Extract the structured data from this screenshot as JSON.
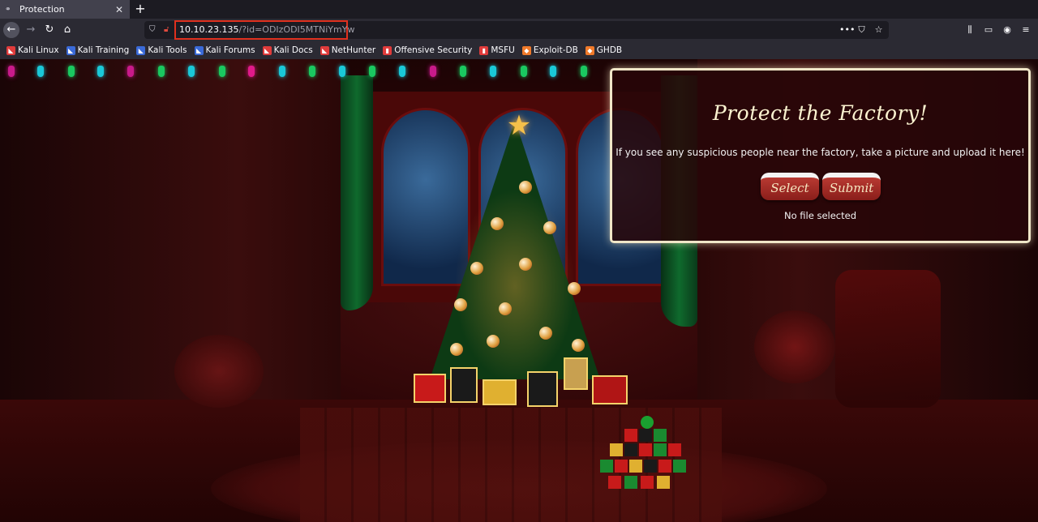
{
  "browser": {
    "tab": {
      "title": "Protection"
    },
    "url": {
      "host": "10.10.23.135",
      "path": "/?id=ODIzODI5MTNiYmYw"
    },
    "bookmarks": [
      {
        "label": "Kali Linux",
        "icon": "kali-icon",
        "color": "#e03b3b"
      },
      {
        "label": "Kali Training",
        "icon": "kali-training-icon",
        "color": "#3a6ad8"
      },
      {
        "label": "Kali Tools",
        "icon": "kali-tools-icon",
        "color": "#3a6ad8"
      },
      {
        "label": "Kali Forums",
        "icon": "kali-forums-icon",
        "color": "#3a6ad8"
      },
      {
        "label": "Kali Docs",
        "icon": "kali-docs-icon",
        "color": "#e03b3b"
      },
      {
        "label": "NetHunter",
        "icon": "nethunter-icon",
        "color": "#e03b3b"
      },
      {
        "label": "Offensive Security",
        "icon": "offsec-icon",
        "color": "#e03b3b"
      },
      {
        "label": "MSFU",
        "icon": "msfu-icon",
        "color": "#e03b3b"
      },
      {
        "label": "Exploit-DB",
        "icon": "exploitdb-icon",
        "color": "#f07a2a"
      },
      {
        "label": "GHDB",
        "icon": "ghdb-icon",
        "color": "#f07a2a"
      }
    ]
  },
  "page": {
    "title": "Protect the Factory!",
    "instruction": "If you see any suspicious people near the factory, take a picture and upload it here!",
    "select_label": "Select",
    "submit_label": "Submit",
    "file_status": "No file selected"
  },
  "colors": {
    "accent": "#e0301e",
    "panel_border": "#f0e6c8",
    "button": "#a52a24"
  }
}
